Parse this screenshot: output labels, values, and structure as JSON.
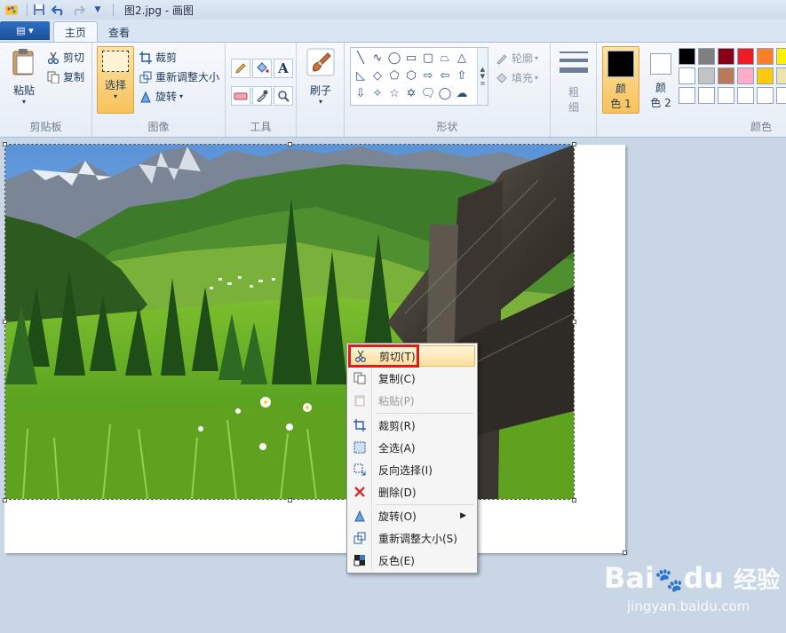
{
  "titlebar": {
    "title": "图2.jpg - 画图",
    "quick_access": [
      "save-icon",
      "undo-icon",
      "redo-icon",
      "customize-icon"
    ]
  },
  "tabs": {
    "file_label": "▤ ▾",
    "items": [
      {
        "label": "主页",
        "active": true
      },
      {
        "label": "查看",
        "active": false
      }
    ]
  },
  "ribbon": {
    "clipboard": {
      "paste": "粘贴",
      "cut": "剪切",
      "copy": "复制",
      "label": "剪贴板"
    },
    "image": {
      "select": "选择",
      "crop": "裁剪",
      "resize": "重新调整大小",
      "rotate": "旋转",
      "label": "图像"
    },
    "tools": {
      "label": "工具"
    },
    "brush": {
      "label": "刷子"
    },
    "shapes": {
      "outline": "轮廓",
      "fill": "填充",
      "label": "形状"
    },
    "size": {
      "label_line1": "粗",
      "label_line2": "细"
    },
    "colors": {
      "color1_line1": "颜",
      "color1_line2": "色 1",
      "color2_line1": "颜",
      "color2_line2": "色 2",
      "label": "颜色",
      "color1": "#000000",
      "color2": "#ffffff",
      "palette_row1": [
        "#000000",
        "#7f7f7f",
        "#880015",
        "#ed1c24",
        "#ff7f27",
        "#fff200"
      ],
      "palette_row2": [
        "#ffffff",
        "#c3c3c3",
        "#b97a57",
        "#ffaec9",
        "#ffc90e",
        "#efe4b0"
      ],
      "palette_row3": [
        "#ffffff",
        "#ffffff",
        "#ffffff",
        "#ffffff",
        "#ffffff",
        "#ffffff"
      ]
    }
  },
  "context_menu": {
    "items": [
      {
        "label": "剪切(T)",
        "icon": "scissors-icon",
        "enabled": true,
        "highlighted": true
      },
      {
        "label": "复制(C)",
        "icon": "copy-icon",
        "enabled": true
      },
      {
        "label": "粘贴(P)",
        "icon": "paste-icon",
        "enabled": false
      },
      {
        "label": "裁剪(R)",
        "icon": "crop-icon",
        "enabled": true
      },
      {
        "label": "全选(A)",
        "icon": "select-all-icon",
        "enabled": true
      },
      {
        "label": "反向选择(I)",
        "icon": "invert-selection-icon",
        "enabled": true
      },
      {
        "label": "删除(D)",
        "icon": "delete-icon",
        "enabled": true
      },
      {
        "label": "旋转(O)",
        "icon": "rotate-icon",
        "enabled": true,
        "submenu": true
      },
      {
        "label": "重新调整大小(S)",
        "icon": "resize-icon",
        "enabled": true
      },
      {
        "label": "反色(E)",
        "icon": "invert-color-icon",
        "enabled": true
      }
    ]
  },
  "watermark": {
    "brand": "Bai",
    "brand2": "du",
    "cn": "经验",
    "url": "jingyan.baidu.com"
  }
}
